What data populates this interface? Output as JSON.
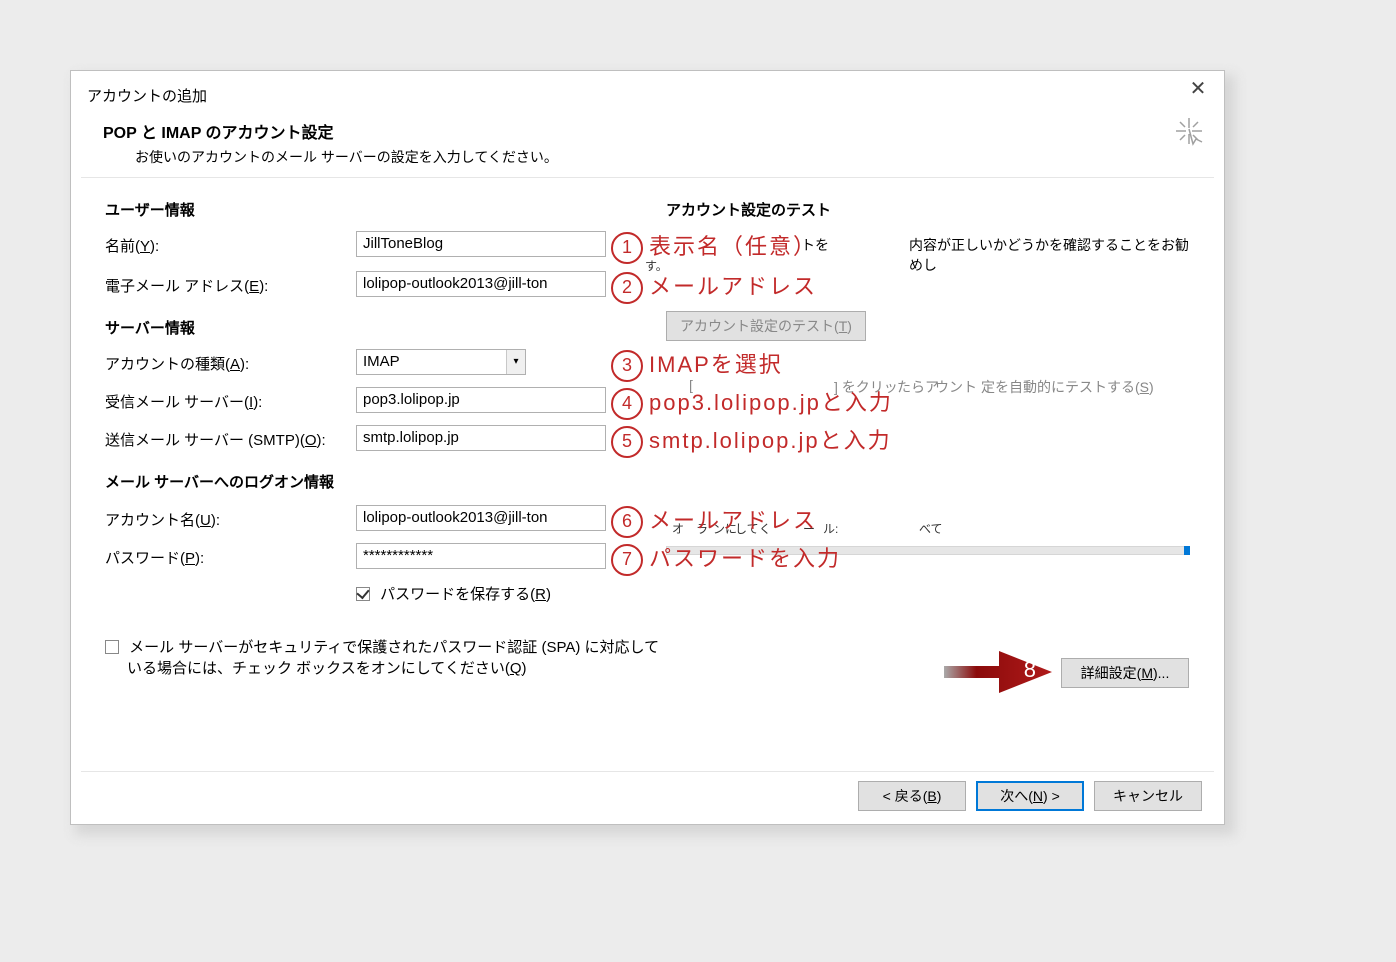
{
  "window": {
    "title": "アカウントの追加"
  },
  "header": {
    "title": "POP と IMAP のアカウント設定",
    "subtitle": "お使いのアカウントのメール サーバーの設定を入力してください。"
  },
  "left": {
    "section_user": "ユーザー情報",
    "name_label": "名前(Y):",
    "name_value": "JillToneBlog",
    "email_label": "電子メール アドレス(E):",
    "email_value": "lolipop-outlook2013@jill-ton",
    "section_server": "サーバー情報",
    "acct_type_label": "アカウントの種類(A):",
    "acct_type_value": "IMAP",
    "incoming_label": "受信メール サーバー(I):",
    "incoming_value": "pop3.lolipop.jp",
    "outgoing_label": "送信メール サーバー (SMTP)(O):",
    "outgoing_value": "smtp.lolipop.jp",
    "section_logon": "メール サーバーへのログオン情報",
    "acct_name_label": "アカウント名(U):",
    "acct_name_value": "lolipop-outlook2013@jill-ton",
    "password_label": "パスワード(P):",
    "password_value": "************",
    "remember_pw": "パスワードを保存する(R)",
    "spa_line1": "メール サーバーがセキュリティで保護されたパスワード認証 (SPA) に対応して",
    "spa_line2": "いる場合には、チェック ボックスをオンにしてください(Q)"
  },
  "right": {
    "section_test": "アカウント設定のテスト",
    "test_desc_frag_1": "トを",
    "test_desc_frag_2": "内容が正しいかどうかを確認することをお勧めし",
    "test_desc_frag_3": "す。",
    "test_btn": "アカウント設定のテスト(T)",
    "autotest_frag_1": "[",
    "autotest_frag_2": "] をクリッ",
    "autotest_frag_3": "たらア",
    "autotest_frag_4": "ウント",
    "autotest_frag_5": "定を自動的にテストする(S)",
    "offline_frag_1": "オ",
    "offline_frag_2": "ラ",
    "offline_frag_3": "ンに",
    "offline_frag_4": "して",
    "offline_frag_5": "く",
    "offline_frag_6": "ー",
    "offline_frag_7": "ル:",
    "offline_frag_8": "べて",
    "advanced_btn": "詳細設定(M)..."
  },
  "footer": {
    "back": "< 戻る(B)",
    "next": "次へ(N) >",
    "cancel": "キャンセル"
  },
  "annot": {
    "a1": "表示名（任意）",
    "a2": "メールアドレス",
    "a3": "IMAPを選択",
    "a4": "pop3.lolipop.jpと入力",
    "a5": "smtp.lolipop.jpと入力",
    "a6": "メールアドレス",
    "a7": "パスワードを入力",
    "n1": "1",
    "n2": "2",
    "n3": "3",
    "n4": "4",
    "n5": "5",
    "n6": "6",
    "n7": "7",
    "n8": "8"
  }
}
